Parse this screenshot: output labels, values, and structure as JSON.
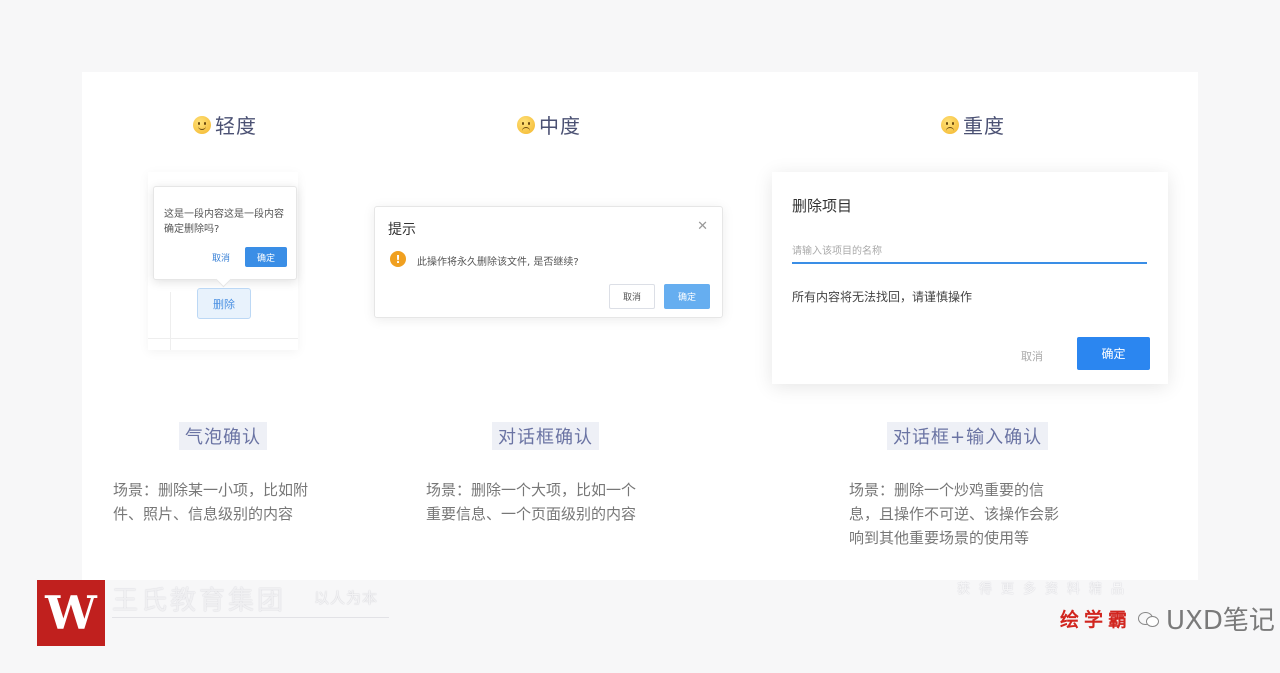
{
  "levels": [
    {
      "label": "轻度",
      "icon": "slightly-smiling-face-icon"
    },
    {
      "label": "中度",
      "icon": "disappointed-face-icon"
    },
    {
      "label": "重度",
      "icon": "crying-face-icon"
    }
  ],
  "bubble": {
    "message": "这是一段内容这是一段内容确定删除吗?",
    "cancel_label": "取消",
    "confirm_label": "确定",
    "delete_label": "删除"
  },
  "dialog": {
    "title": "提示",
    "close_icon": "close-icon",
    "message": "此操作将永久删除该文件, 是否继续?",
    "cancel_label": "取消",
    "confirm_label": "确定"
  },
  "input_dialog": {
    "title": "删除项目",
    "input_placeholder": "请输入该项目的名称",
    "warning": "所有内容将无法找回，请谨慎操作",
    "cancel_label": "取消",
    "confirm_label": "确定"
  },
  "methods": [
    {
      "name": "气泡确认",
      "scenario_line1": "场景：删除某一小项，比如附",
      "scenario_line2": "件、照片、信息级别的内容"
    },
    {
      "name": "对话框确认",
      "scenario_line1": "场景：删除一个大项，比如一个",
      "scenario_line2": "重要信息、一个页面级别的内容"
    },
    {
      "name": "对话框+输入确认",
      "scenario_line1": "场景：删除一个炒鸡重要的信",
      "scenario_line2": "息，且操作不可逆、该操作会影",
      "scenario_line3": "响到其他重要场景的使用等"
    }
  ],
  "watermark": {
    "logo_letter": "W",
    "company": "王氏教育集团",
    "slogan": "以人为本",
    "more": "获得更多资料精品",
    "brand_red": "绘学霸",
    "brand_gray": "UXD笔记"
  },
  "colors": {
    "primary": "#2b86f0",
    "warning": "#f0a020",
    "method_text": "#6a73a3",
    "logo_red": "#c0201e"
  }
}
